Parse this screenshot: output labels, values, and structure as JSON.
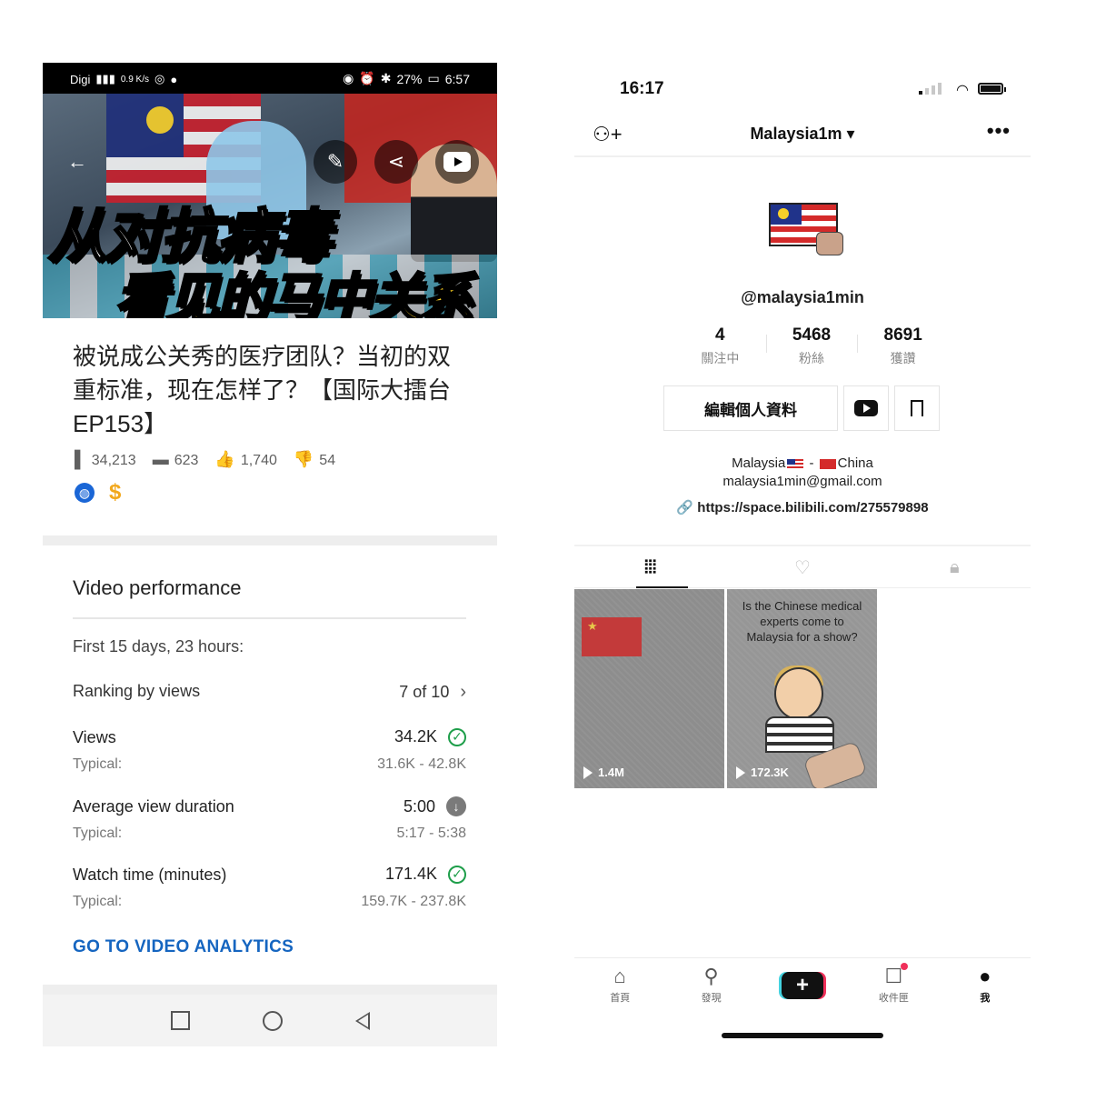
{
  "left": {
    "status": {
      "carrier": "Digi",
      "speed": "0.9 K/s",
      "battery": "27%",
      "time": "6:57"
    },
    "thumbnail": {
      "line1": "从对抗病毒",
      "line2": "看见的马中关系"
    },
    "video": {
      "title": "被说成公关秀的医疗团队？当初的双重标准，现在怎样了？【国际大擂台EP153】",
      "views": "34,213",
      "comments": "623",
      "likes": "1,740",
      "dislikes": "54"
    },
    "performance": {
      "heading": "Video performance",
      "period": "First 15 days, 23 hours:",
      "ranking_label": "Ranking by views",
      "ranking_value": "7 of 10",
      "metrics": [
        {
          "label": "Views",
          "value": "34.2K",
          "typical_label": "Typical:",
          "typical": "31.6K - 42.8K",
          "status": "check"
        },
        {
          "label": "Average view duration",
          "value": "5:00",
          "typical_label": "Typical:",
          "typical": "5:17 - 5:38",
          "status": "down"
        },
        {
          "label": "Watch time (minutes)",
          "value": "171.4K",
          "typical_label": "Typical:",
          "typical": "159.7K - 237.8K",
          "status": "check"
        }
      ],
      "cta": "GO TO VIDEO ANALYTICS"
    }
  },
  "right": {
    "status": {
      "time": "16:17"
    },
    "header": {
      "username": "Malaysia1m ▾"
    },
    "profile": {
      "handle": "@malaysia1min",
      "stats": [
        {
          "value": "4",
          "label": "關注中"
        },
        {
          "value": "5468",
          "label": "粉絲"
        },
        {
          "value": "8691",
          "label": "獲讚"
        }
      ],
      "edit_button": "編輯個人資料",
      "bio_country_a": "Malaysia",
      "bio_dash": "-",
      "bio_country_b": "China",
      "bio_email": "malaysia1min@gmail.com",
      "link": "https://space.bilibili.com/275579898"
    },
    "videos": [
      {
        "plays": "1.4M"
      },
      {
        "caption": "Is the Chinese medical experts come to Malaysia for a show?",
        "plays": "172.3K"
      }
    ],
    "tabbar": {
      "home": "首頁",
      "discover": "發現",
      "plus": "+",
      "inbox": "收件匣",
      "me": "我"
    }
  }
}
